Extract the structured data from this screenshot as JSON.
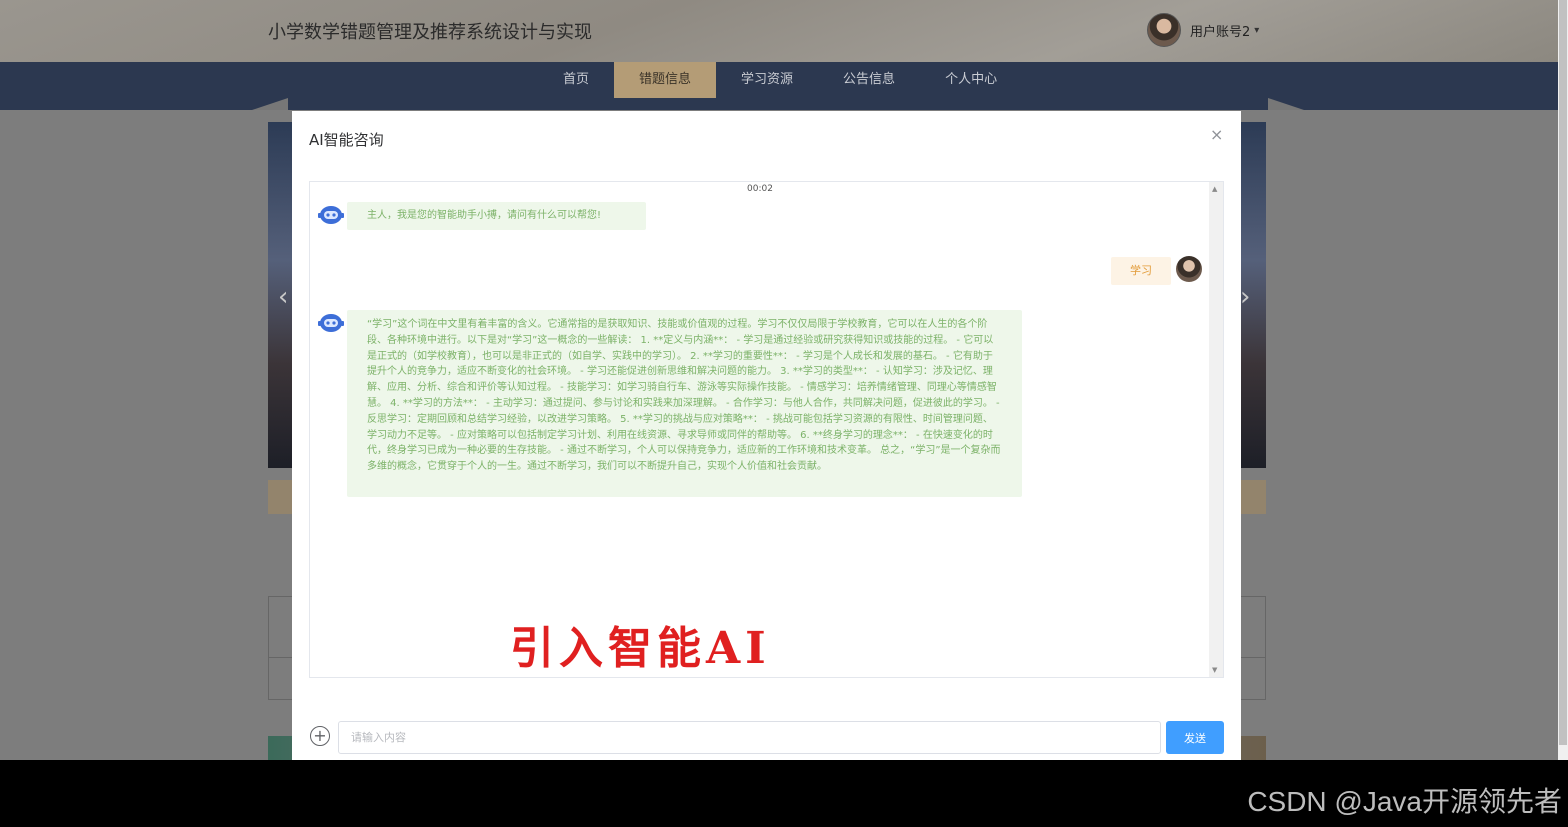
{
  "site": {
    "title": "小学数学错题管理及推荐系统设计与实现",
    "user_name": "用户账号2",
    "caret": "▾"
  },
  "nav": {
    "items": [
      {
        "label": "首页",
        "active": false
      },
      {
        "label": "错题信息",
        "active": true
      },
      {
        "label": "学习资源",
        "active": false
      },
      {
        "label": "公告信息",
        "active": false
      },
      {
        "label": "个人中心",
        "active": false
      }
    ]
  },
  "dialog": {
    "title": "AI智能咨询",
    "close_glyph": "×",
    "time": "00:02",
    "messages": [
      {
        "from": "bot",
        "text": "主人，我是您的智能助手小搏，请问有什么可以帮您!"
      },
      {
        "from": "user",
        "text": "学习"
      },
      {
        "from": "bot",
        "text": "“学习”这个词在中文里有着丰富的含义。它通常指的是获取知识、技能或价值观的过程。学习不仅仅局限于学校教育，它可以在人生的各个阶段、各种环境中进行。以下是对“学习”这一概念的一些解读： 1. **定义与内涵**： - 学习是通过经验或研究获得知识或技能的过程。 - 它可以是正式的（如学校教育），也可以是非正式的（如自学、实践中的学习）。 2. **学习的重要性**： - 学习是个人成长和发展的基石。 - 它有助于提升个人的竞争力，适应不断变化的社会环境。 - 学习还能促进创新思维和解决问题的能力。 3. **学习的类型**： - 认知学习：涉及记忆、理解、应用、分析、综合和评价等认知过程。 - 技能学习：如学习骑自行车、游泳等实际操作技能。 - 情感学习：培养情绪管理、同理心等情感智慧。 4. **学习的方法**： - 主动学习：通过提问、参与讨论和实践来加深理解。 - 合作学习：与他人合作，共同解决问题，促进彼此的学习。 - 反思学习：定期回顾和总结学习经验，以改进学习策略。 5. **学习的挑战与应对策略**： - 挑战可能包括学习资源的有限性、时间管理问题、学习动力不足等。 - 应对策略可以包括制定学习计划、利用在线资源、寻求导师或同伴的帮助等。 6. **终身学习的理念**： - 在快速变化的时代，终身学习已成为一种必要的生存技能。 - 通过不断学习，个人可以保持竞争力，适应新的工作环境和技术变革。 总之，“学习”是一个复杂而多维的概念，它贯穿于个人的一生。通过不断学习，我们可以不断提升自己，实现个人价值和社会贡献。"
      }
    ],
    "overlay_label": "引入智能AI",
    "input": {
      "placeholder": "请输入内容",
      "value": ""
    },
    "plus_glyph": "+",
    "send_label": "发送"
  },
  "background": {
    "arrow_left": "‹",
    "arrow_right": "›"
  },
  "watermark": "CSDN @Java开源领先者",
  "colors": {
    "nav_bg": "#2c3850",
    "nav_active": "#b49c76",
    "bot_bubble": "#eef7ea",
    "bot_text": "#7cb268",
    "user_bubble": "#fdf3e5",
    "user_text": "#e29b38",
    "send_button": "#409eff",
    "overlay_label": "#e02020"
  }
}
